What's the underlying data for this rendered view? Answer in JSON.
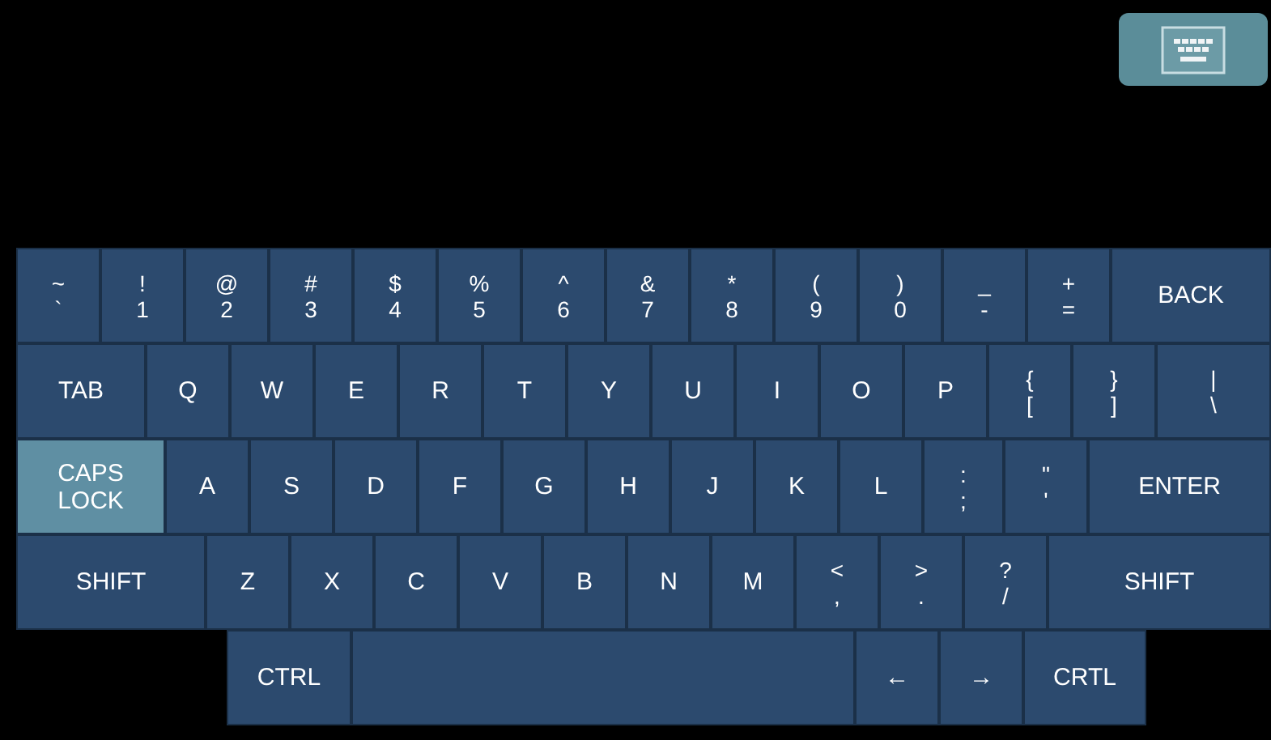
{
  "keyboard_toggle": {
    "active": true
  },
  "rows": [
    [
      {
        "kind": "dual",
        "lines": [
          "~",
          "`"
        ],
        "on": false
      },
      {
        "kind": "dual",
        "lines": [
          "!",
          "1"
        ],
        "on": false
      },
      {
        "kind": "dual",
        "lines": [
          "@",
          "2"
        ],
        "on": false
      },
      {
        "kind": "dual",
        "lines": [
          "#",
          "3"
        ],
        "on": false
      },
      {
        "kind": "dual",
        "lines": [
          "$",
          "4"
        ],
        "on": false
      },
      {
        "kind": "dual",
        "lines": [
          "%",
          "5"
        ],
        "on": false
      },
      {
        "kind": "dual",
        "lines": [
          "^",
          "6"
        ],
        "on": false
      },
      {
        "kind": "dual",
        "lines": [
          "&",
          "7"
        ],
        "on": false
      },
      {
        "kind": "dual",
        "lines": [
          "*",
          "8"
        ],
        "on": false
      },
      {
        "kind": "dual",
        "lines": [
          "(",
          "9"
        ],
        "on": false
      },
      {
        "kind": "dual",
        "lines": [
          ")",
          "0"
        ],
        "on": false
      },
      {
        "kind": "dual",
        "lines": [
          "_",
          "-"
        ],
        "on": false
      },
      {
        "kind": "dual",
        "lines": [
          "+",
          "="
        ],
        "on": false
      },
      {
        "kind": "label",
        "lines": [
          "BACK"
        ],
        "on": false
      }
    ],
    [
      {
        "kind": "label",
        "lines": [
          "TAB"
        ],
        "on": false
      },
      {
        "kind": "label",
        "lines": [
          "Q"
        ],
        "on": false
      },
      {
        "kind": "label",
        "lines": [
          "W"
        ],
        "on": false
      },
      {
        "kind": "label",
        "lines": [
          "E"
        ],
        "on": false
      },
      {
        "kind": "label",
        "lines": [
          "R"
        ],
        "on": false
      },
      {
        "kind": "label",
        "lines": [
          "T"
        ],
        "on": false
      },
      {
        "kind": "label",
        "lines": [
          "Y"
        ],
        "on": false
      },
      {
        "kind": "label",
        "lines": [
          "U"
        ],
        "on": false
      },
      {
        "kind": "label",
        "lines": [
          "I"
        ],
        "on": false
      },
      {
        "kind": "label",
        "lines": [
          "O"
        ],
        "on": false
      },
      {
        "kind": "label",
        "lines": [
          "P"
        ],
        "on": false
      },
      {
        "kind": "dual",
        "lines": [
          "{",
          "["
        ],
        "on": false
      },
      {
        "kind": "dual",
        "lines": [
          "}",
          "]"
        ],
        "on": false
      },
      {
        "kind": "dual",
        "lines": [
          "|",
          "\\"
        ],
        "on": false
      }
    ],
    [
      {
        "kind": "label",
        "lines": [
          "CAPS",
          "LOCK"
        ],
        "on": true
      },
      {
        "kind": "label",
        "lines": [
          "A"
        ],
        "on": false
      },
      {
        "kind": "label",
        "lines": [
          "S"
        ],
        "on": false
      },
      {
        "kind": "label",
        "lines": [
          "D"
        ],
        "on": false
      },
      {
        "kind": "label",
        "lines": [
          "F"
        ],
        "on": false
      },
      {
        "kind": "label",
        "lines": [
          "G"
        ],
        "on": false
      },
      {
        "kind": "label",
        "lines": [
          "H"
        ],
        "on": false
      },
      {
        "kind": "label",
        "lines": [
          "J"
        ],
        "on": false
      },
      {
        "kind": "label",
        "lines": [
          "K"
        ],
        "on": false
      },
      {
        "kind": "label",
        "lines": [
          "L"
        ],
        "on": false
      },
      {
        "kind": "dual",
        "lines": [
          ":",
          ";"
        ],
        "on": false
      },
      {
        "kind": "dual",
        "lines": [
          "\"",
          "'"
        ],
        "on": false
      },
      {
        "kind": "label",
        "lines": [
          "ENTER"
        ],
        "on": false
      }
    ],
    [
      {
        "kind": "label",
        "lines": [
          "SHIFT"
        ],
        "on": false
      },
      {
        "kind": "label",
        "lines": [
          "Z"
        ],
        "on": false
      },
      {
        "kind": "label",
        "lines": [
          "X"
        ],
        "on": false
      },
      {
        "kind": "label",
        "lines": [
          "C"
        ],
        "on": false
      },
      {
        "kind": "label",
        "lines": [
          "V"
        ],
        "on": false
      },
      {
        "kind": "label",
        "lines": [
          "B"
        ],
        "on": false
      },
      {
        "kind": "label",
        "lines": [
          "N"
        ],
        "on": false
      },
      {
        "kind": "label",
        "lines": [
          "M"
        ],
        "on": false
      },
      {
        "kind": "dual",
        "lines": [
          "<",
          ","
        ],
        "on": false
      },
      {
        "kind": "dual",
        "lines": [
          ">",
          "."
        ],
        "on": false
      },
      {
        "kind": "dual",
        "lines": [
          "?",
          "/"
        ],
        "on": false
      },
      {
        "kind": "label",
        "lines": [
          "SHIFT"
        ],
        "on": false
      }
    ],
    [
      {
        "kind": "label",
        "lines": [
          "CTRL"
        ],
        "on": false
      },
      {
        "kind": "space",
        "on": false
      },
      {
        "kind": "label",
        "lines": [
          "←"
        ],
        "on": false
      },
      {
        "kind": "label",
        "lines": [
          "→"
        ],
        "on": false
      },
      {
        "kind": "label",
        "lines": [
          "CRTL"
        ],
        "on": false
      }
    ]
  ]
}
